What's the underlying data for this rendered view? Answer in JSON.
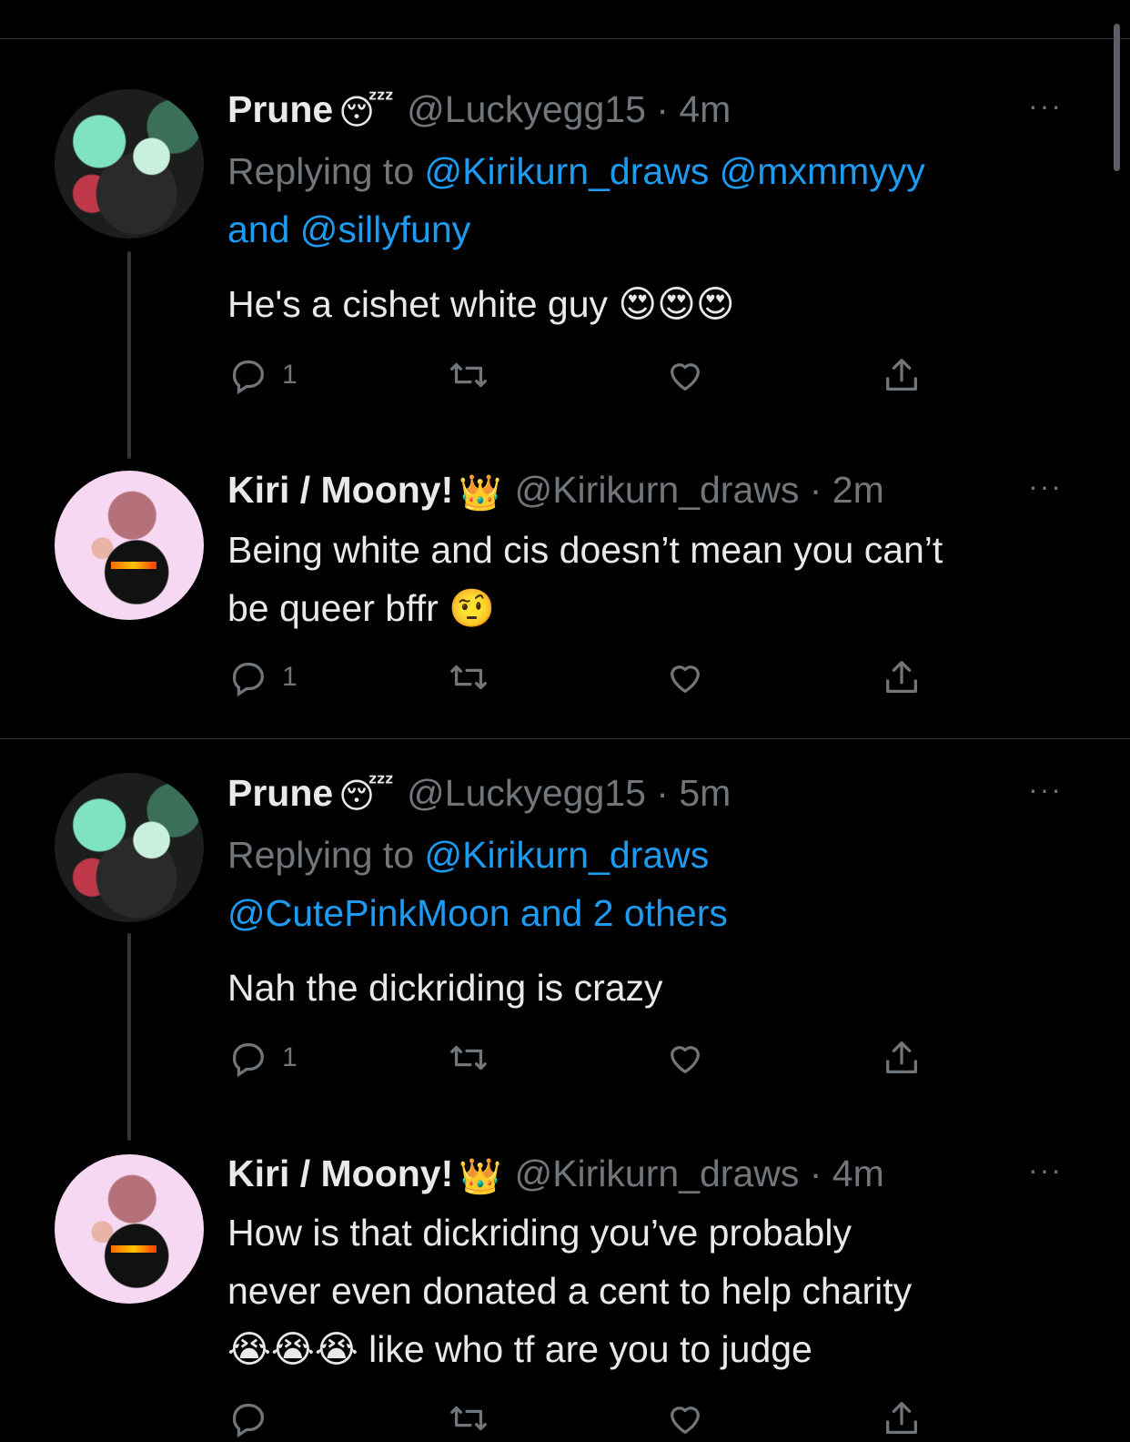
{
  "tweets": [
    {
      "name": "Prune",
      "badge": "😴",
      "handle": "@Luckyegg15 · 4m",
      "more": "···",
      "replying_prefix": "Replying to ",
      "replying_links_1": "@Kirikurn_draws @mxmmyyy",
      "replying_links_2": "and @sillyfuny",
      "body": "He's a cishet white guy 😍😍😍",
      "reply_count": "1"
    },
    {
      "name": "Kiri / Moony!",
      "badge": "👑",
      "handle": "@Kirikurn_draws · 2m",
      "more": "···",
      "body_1": "Being white and cis doesn’t mean you can’t",
      "body_2": "be queer bffr 🤨",
      "reply_count": "1"
    },
    {
      "name": "Prune",
      "badge": "😴",
      "handle": "@Luckyegg15 · 5m",
      "more": "···",
      "replying_prefix": "Replying to ",
      "replying_links_1": "@Kirikurn_draws",
      "replying_links_2": "@CutePinkMoon and 2 others",
      "body": "Nah the dickriding is crazy",
      "reply_count": "1"
    },
    {
      "name": "Kiri / Moony!",
      "badge": "👑",
      "handle": "@Kirikurn_draws · 4m",
      "more": "···",
      "body_1": "How is that dickriding you’ve probably",
      "body_2": "never even donated a cent to help charity",
      "body_3": "😭😭😭 like who tf are you to judge"
    }
  ],
  "icons": [
    "reply-icon",
    "retweet-icon",
    "like-icon",
    "share-icon",
    "more-icon"
  ],
  "colors": {
    "background": "#000000",
    "text": "#e7e9ea",
    "secondary": "#71767b",
    "link": "#1d9bf0",
    "divider": "#2f3336"
  }
}
